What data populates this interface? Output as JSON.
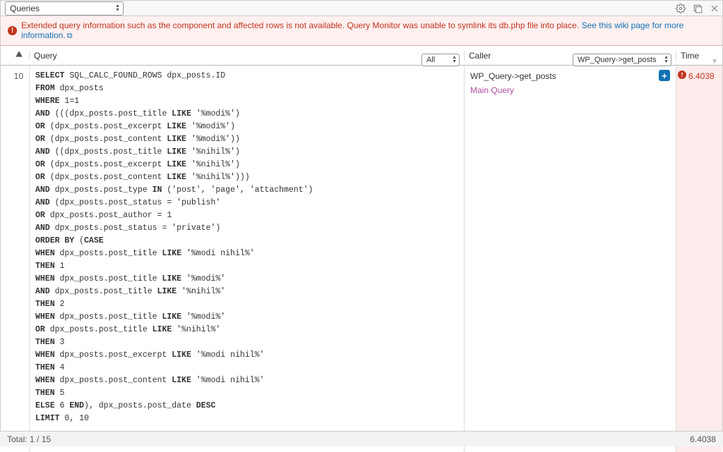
{
  "topbar": {
    "select_label": "Queries"
  },
  "notice": {
    "text": "Extended query information such as the component and affected rows is not available. Query Monitor was unable to symlink its db.php file into place.",
    "link": "See this wiki page for more information."
  },
  "columns": {
    "query": "Query",
    "query_filter": "All",
    "caller": "Caller",
    "caller_filter": "WP_Query->get_posts",
    "time": "Time"
  },
  "row": {
    "num": "10",
    "caller_main": "WP_Query->get_posts",
    "caller_sub": "Main Query",
    "time": "6.4038"
  },
  "sql": [
    [
      [
        "kw",
        "SELECT"
      ],
      [
        "",
        " SQL_CALC_FOUND_ROWS dpx_posts.ID"
      ]
    ],
    [
      [
        "kw",
        "FROM"
      ],
      [
        "",
        " dpx_posts"
      ]
    ],
    [
      [
        "kw",
        "WHERE"
      ],
      [
        "",
        " 1=1"
      ]
    ],
    [
      [
        "kw",
        "AND"
      ],
      [
        "",
        " (((dpx_posts.post_title "
      ],
      [
        "kw",
        "LIKE"
      ],
      [
        "",
        " '%modi%')"
      ]
    ],
    [
      [
        "kw",
        "OR"
      ],
      [
        "",
        " (dpx_posts.post_excerpt "
      ],
      [
        "kw",
        "LIKE"
      ],
      [
        "",
        " '%modi%')"
      ]
    ],
    [
      [
        "kw",
        "OR"
      ],
      [
        "",
        " (dpx_posts.post_content "
      ],
      [
        "kw",
        "LIKE"
      ],
      [
        "",
        " '%modi%'))"
      ]
    ],
    [
      [
        "kw",
        "AND"
      ],
      [
        "",
        " ((dpx_posts.post_title "
      ],
      [
        "kw",
        "LIKE"
      ],
      [
        "",
        " '%nihil%')"
      ]
    ],
    [
      [
        "kw",
        "OR"
      ],
      [
        "",
        " (dpx_posts.post_excerpt "
      ],
      [
        "kw",
        "LIKE"
      ],
      [
        "",
        " '%nihil%')"
      ]
    ],
    [
      [
        "kw",
        "OR"
      ],
      [
        "",
        " (dpx_posts.post_content "
      ],
      [
        "kw",
        "LIKE"
      ],
      [
        "",
        " '%nihil%')))"
      ]
    ],
    [
      [
        "kw",
        "AND"
      ],
      [
        "",
        " dpx_posts.post_type "
      ],
      [
        "kw",
        "IN"
      ],
      [
        "",
        " ('post', 'page', 'attachment')"
      ]
    ],
    [
      [
        "kw",
        "AND"
      ],
      [
        "",
        " (dpx_posts.post_status = 'publish'"
      ]
    ],
    [
      [
        "kw",
        "OR"
      ],
      [
        "",
        " dpx_posts.post_author = 1"
      ]
    ],
    [
      [
        "kw",
        "AND"
      ],
      [
        "",
        " dpx_posts.post_status = 'private')"
      ]
    ],
    [
      [
        "kw",
        "ORDER BY"
      ],
      [
        "",
        " ("
      ],
      [
        "kw",
        "CASE"
      ]
    ],
    [
      [
        "kw",
        "WHEN"
      ],
      [
        "",
        " dpx_posts.post_title "
      ],
      [
        "kw",
        "LIKE"
      ],
      [
        "",
        " '%modi nihil%'"
      ]
    ],
    [
      [
        "kw",
        "THEN"
      ],
      [
        "",
        " 1"
      ]
    ],
    [
      [
        "kw",
        "WHEN"
      ],
      [
        "",
        " dpx_posts.post_title "
      ],
      [
        "kw",
        "LIKE"
      ],
      [
        "",
        " '%modi%'"
      ]
    ],
    [
      [
        "kw",
        "AND"
      ],
      [
        "",
        " dpx_posts.post_title "
      ],
      [
        "kw",
        "LIKE"
      ],
      [
        "",
        " '%nihil%'"
      ]
    ],
    [
      [
        "kw",
        "THEN"
      ],
      [
        "",
        " 2"
      ]
    ],
    [
      [
        "kw",
        "WHEN"
      ],
      [
        "",
        " dpx_posts.post_title "
      ],
      [
        "kw",
        "LIKE"
      ],
      [
        "",
        " '%modi%'"
      ]
    ],
    [
      [
        "kw",
        "OR"
      ],
      [
        "",
        " dpx_posts.post_title "
      ],
      [
        "kw",
        "LIKE"
      ],
      [
        "",
        " '%nihil%'"
      ]
    ],
    [
      [
        "kw",
        "THEN"
      ],
      [
        "",
        " 3"
      ]
    ],
    [
      [
        "kw",
        "WHEN"
      ],
      [
        "",
        " dpx_posts.post_excerpt "
      ],
      [
        "kw",
        "LIKE"
      ],
      [
        "",
        " '%modi nihil%'"
      ]
    ],
    [
      [
        "kw",
        "THEN"
      ],
      [
        "",
        " 4"
      ]
    ],
    [
      [
        "kw",
        "WHEN"
      ],
      [
        "",
        " dpx_posts.post_content "
      ],
      [
        "kw",
        "LIKE"
      ],
      [
        "",
        " '%modi nihil%'"
      ]
    ],
    [
      [
        "kw",
        "THEN"
      ],
      [
        "",
        " 5"
      ]
    ],
    [
      [
        "kw",
        "ELSE"
      ],
      [
        "",
        " 6 "
      ],
      [
        "kw",
        "END"
      ],
      [
        "",
        "), dpx_posts.post_date "
      ],
      [
        "kw",
        "DESC"
      ]
    ],
    [
      [
        "kw",
        "LIMIT"
      ],
      [
        "",
        " 0, 10"
      ]
    ]
  ],
  "footer": {
    "total": "Total: 1 / 15",
    "time": "6.4038"
  }
}
